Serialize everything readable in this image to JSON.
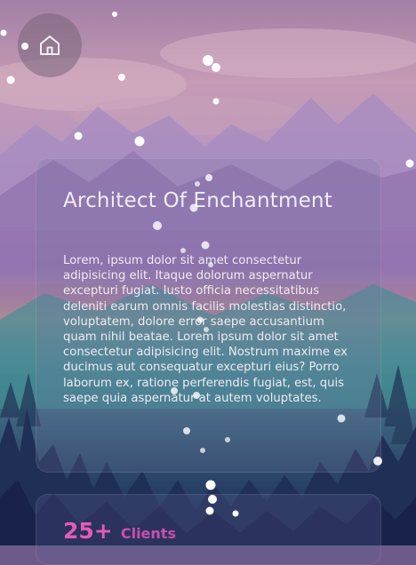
{
  "hero": {
    "title": "Architect Of Enchantment",
    "body": "Lorem, ipsum dolor sit amet consectetur adipisicing elit. Itaque dolorum aspernatur excepturi fugiat. Iusto officia necessitatibus deleniti earum omnis facilis molestias distinctio, voluptatem, dolore error saepe accusantium quam nihil beatae. Lorem ipsum dolor sit amet consectetur adipisicing elit. Nostrum maxime ex ducimus aut consequatur excepturi eius? Porro laborum ex, ratione perferendis fugiat, est, quis saepe quia aspernatur at autem voluptates."
  },
  "stats": {
    "number": "25+",
    "label": "Clients"
  },
  "nav": {
    "home_icon": "home-icon"
  },
  "colors": {
    "accent": "#e45bb6",
    "title": "#f1ecf3"
  }
}
